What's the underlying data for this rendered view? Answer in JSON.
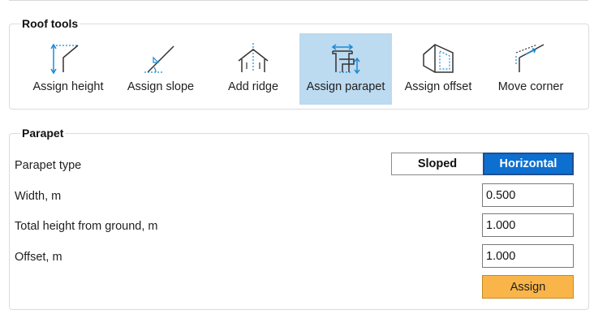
{
  "roof_tools": {
    "title": "Roof tools",
    "tools": [
      {
        "label": "Assign height",
        "icon": "assign-height-icon"
      },
      {
        "label": "Assign slope",
        "icon": "assign-slope-icon"
      },
      {
        "label": "Add ridge",
        "icon": "add-ridge-icon"
      },
      {
        "label": "Assign parapet",
        "icon": "assign-parapet-icon",
        "active": true
      },
      {
        "label": "Assign offset",
        "icon": "assign-offset-icon"
      },
      {
        "label": "Move corner",
        "icon": "move-corner-icon"
      }
    ]
  },
  "parapet": {
    "title": "Parapet",
    "type_label": "Parapet type",
    "type_options": [
      "Sloped",
      "Horizontal"
    ],
    "type_selected": "Horizontal",
    "width_label": "Width, m",
    "width_value": "0.500",
    "height_label": "Total height from ground, m",
    "height_value": "1.000",
    "offset_label": "Offset, m",
    "offset_value": "1.000",
    "assign_label": "Assign"
  },
  "colors": {
    "accent": "#0d6fcf",
    "active_tool_bg": "#bcdaf0",
    "assign_button": "#f9b54a",
    "border": "#dcdcdc"
  }
}
